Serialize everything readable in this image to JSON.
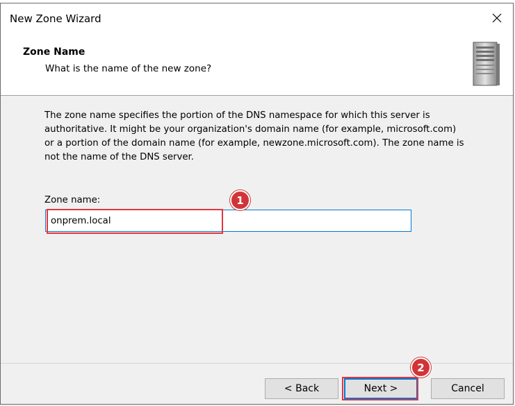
{
  "window": {
    "title": "New Zone Wizard"
  },
  "header": {
    "title": "Zone Name",
    "subtitle": "What is the name of the new zone?"
  },
  "body": {
    "description": "The zone name specifies the portion of the DNS namespace for which this server is\nauthoritative. It might be your organization's domain name (for example,  microsoft.com)\nor a portion of the domain name (for example, newzone.microsoft.com). The zone name is\nnot the name of the DNS server.",
    "zone_name_label": "Zone name:",
    "zone_name_value": "onprem.local"
  },
  "callouts": {
    "one": "1",
    "two": "2"
  },
  "buttons": {
    "back": "< Back",
    "next": "Next >",
    "cancel": "Cancel"
  },
  "colors": {
    "highlight": "#e0363f",
    "focus": "#0078d7",
    "callout": "#d13438"
  }
}
